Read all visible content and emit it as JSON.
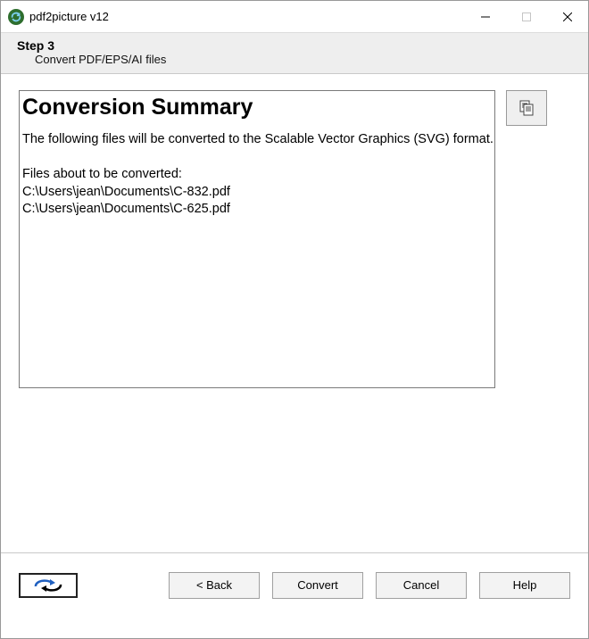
{
  "window": {
    "title": "pdf2picture v12"
  },
  "step": {
    "label": "Step 3",
    "subtitle": "Convert PDF/EPS/AI files"
  },
  "summary": {
    "title": "Conversion Summary",
    "intro": "The following files will be converted to the Scalable Vector Graphics (SVG) format.",
    "files_label": "Files about to be converted:",
    "files": [
      "C:\\Users\\jean\\Documents\\C-832.pdf",
      "C:\\Users\\jean\\Documents\\C-625.pdf"
    ]
  },
  "buttons": {
    "back": "< Back",
    "convert": "Convert",
    "cancel": "Cancel",
    "help": "Help"
  }
}
